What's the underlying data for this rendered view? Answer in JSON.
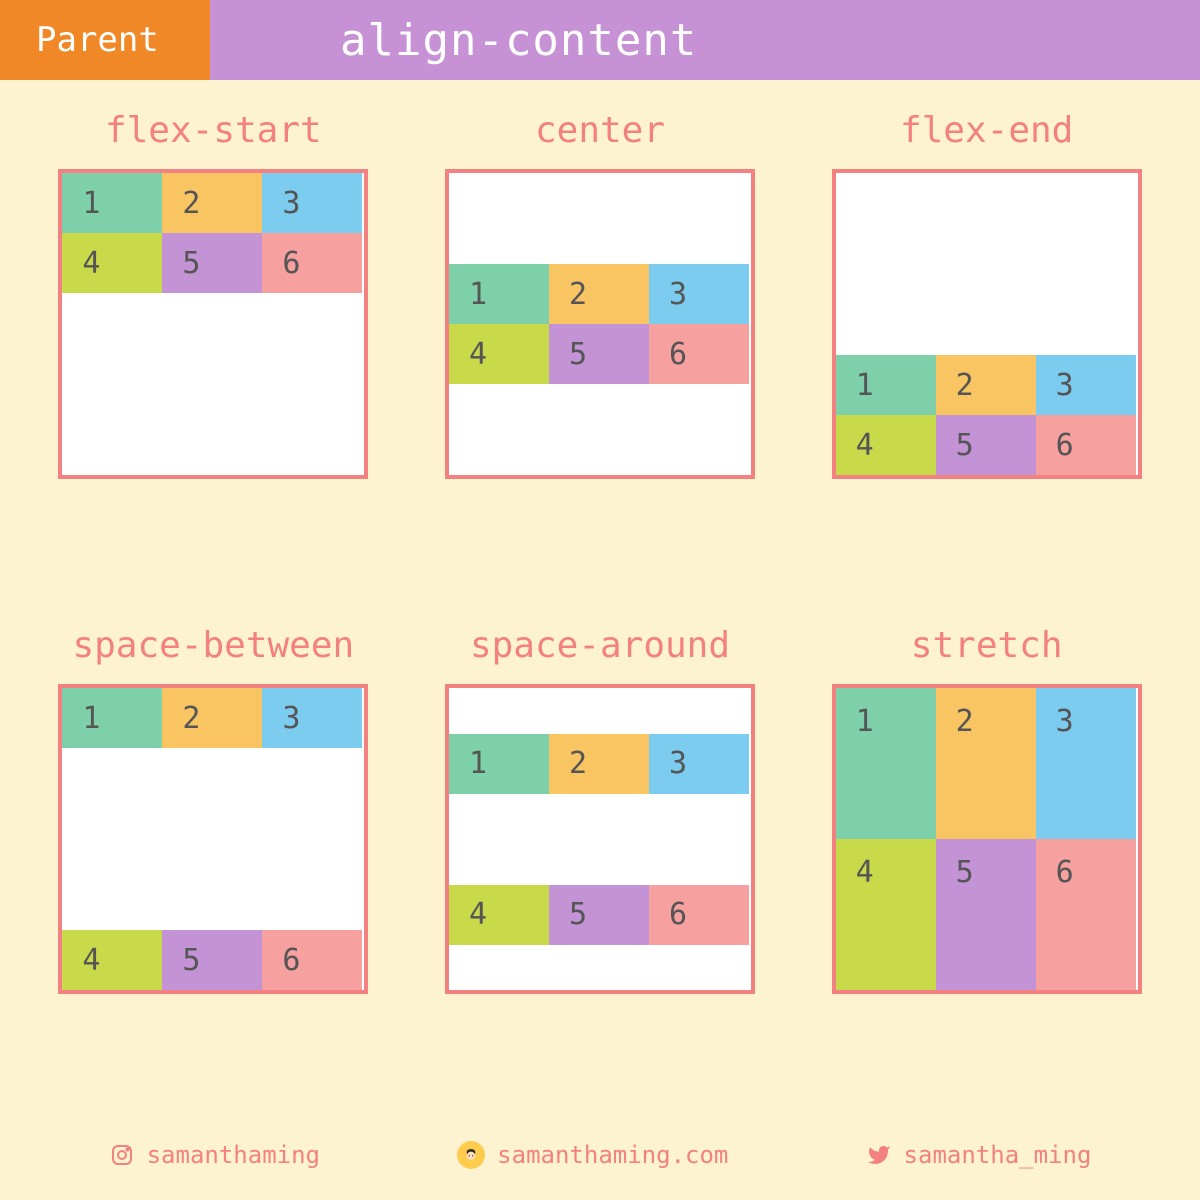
{
  "header": {
    "left": "Parent",
    "right": "align-content"
  },
  "variants": [
    {
      "label": "flex-start",
      "class": "ac-flex-start"
    },
    {
      "label": "center",
      "class": "ac-center"
    },
    {
      "label": "flex-end",
      "class": "ac-flex-end"
    },
    {
      "label": "space-between",
      "class": "ac-space-between"
    },
    {
      "label": "space-around",
      "class": "ac-space-around"
    },
    {
      "label": "stretch",
      "class": "ac-stretch"
    }
  ],
  "items": [
    "1",
    "2",
    "3",
    "4",
    "5",
    "6"
  ],
  "item_colors": [
    "c1",
    "c2",
    "c3",
    "c4",
    "c5",
    "c6"
  ],
  "footer": {
    "instagram": "samanthaming",
    "website": "samanthaming.com",
    "twitter": "samantha_ming"
  },
  "colors": {
    "bg": "#fdf3d0",
    "orange": "#f08827",
    "purple": "#c792d5",
    "coral": "#f38181"
  }
}
